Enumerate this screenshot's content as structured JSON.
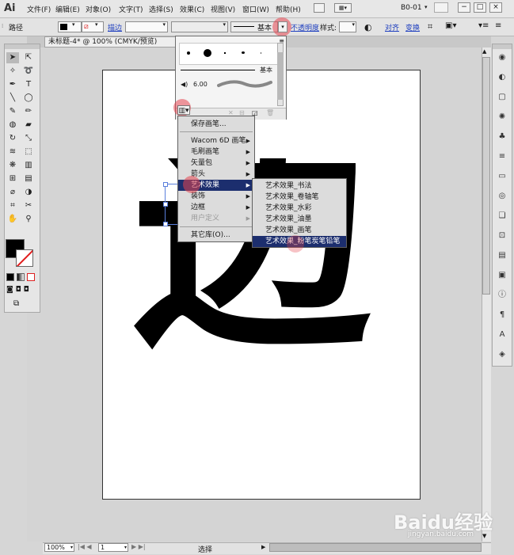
{
  "app": {
    "logo": "Ai",
    "workspace": "B0-01"
  },
  "menubar": [
    "文件(F)",
    "编辑(E)",
    "对象(O)",
    "文字(T)",
    "选择(S)",
    "效果(C)",
    "视图(V)",
    "窗口(W)",
    "帮助(H)"
  ],
  "window_buttons": {
    "minimize": "−",
    "maximize": "□",
    "close": "×"
  },
  "control_bar": {
    "object_label": "路径",
    "stroke_link": "描边",
    "brush_name": "基本",
    "opacity_link": "不透明度",
    "style_label": "样式:",
    "align_link": "对齐",
    "transform_link": "变换"
  },
  "document_tab": {
    "title": "未标题-4* @ 100% (CMYK/预览)",
    "close": "×"
  },
  "brush_panel": {
    "basic_label": "基本",
    "size_value": "6.00"
  },
  "library_menu": {
    "save": "保存画笔...",
    "items": [
      "Wacom 6D 画笔",
      "毛刷画笔",
      "矢量包",
      "箭头",
      "艺术效果",
      "装饰",
      "边框",
      "用户定义"
    ],
    "other": "其它库(O)..."
  },
  "submenu": {
    "items": [
      "艺术效果_书法",
      "艺术效果_卷轴笔",
      "艺术效果_水彩",
      "艺术效果_油墨",
      "艺术效果_画笔",
      "艺术效果_粉笔炭笔铅笔"
    ]
  },
  "artwork": {
    "glyph": "边"
  },
  "status_bar": {
    "zoom": "100%",
    "page": "1",
    "mode": "选择"
  },
  "watermark": {
    "brand": "Baidu经验",
    "url": "jingyan.baidu.com"
  },
  "colors": {
    "menu_highlight": "#1c2e6e",
    "hotspot": "#e64650",
    "link": "#1f3fbf"
  },
  "icons": [
    "selection-tool-icon",
    "direct-selection-icon",
    "magic-wand-icon",
    "lasso-icon",
    "pen-icon",
    "type-icon",
    "line-icon",
    "ellipse-icon",
    "brush-icon",
    "pencil-icon",
    "blob-brush-icon",
    "eraser-icon",
    "rotate-icon",
    "scale-icon",
    "warp-icon",
    "free-transform-icon",
    "symbol-sprayer-icon",
    "graph-icon",
    "mesh-icon",
    "gradient-icon",
    "eyedropper-icon",
    "blend-icon",
    "slice-icon",
    "scissors-icon",
    "hand-icon",
    "zoom-icon"
  ]
}
